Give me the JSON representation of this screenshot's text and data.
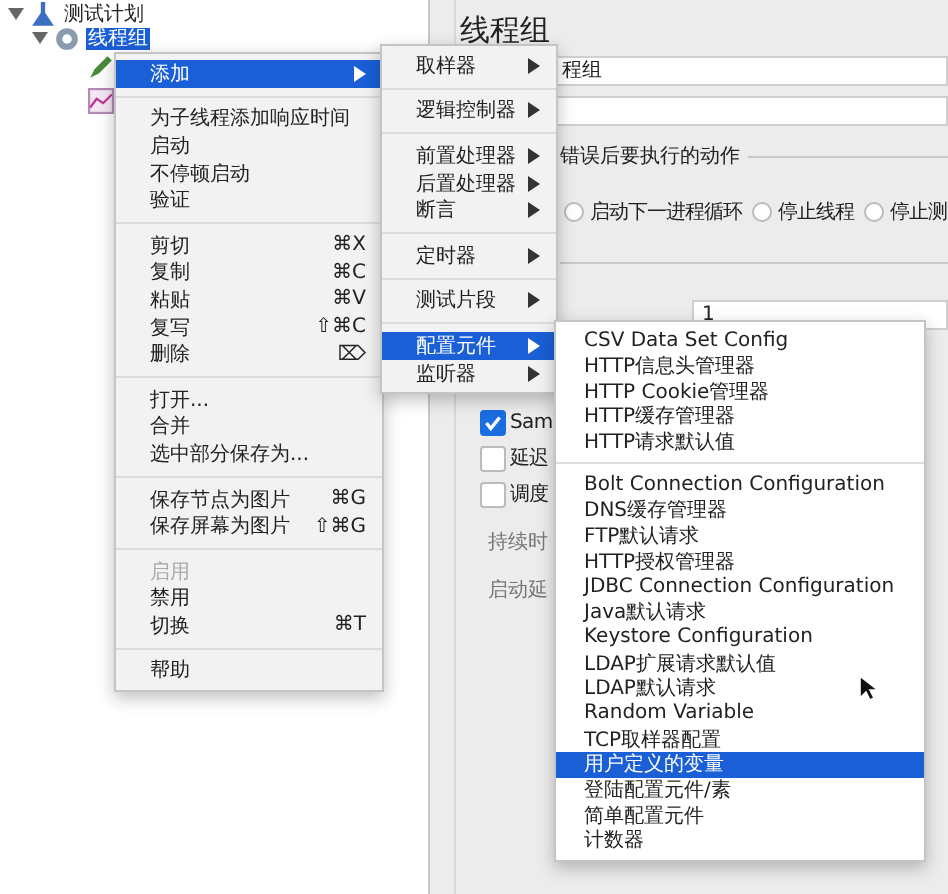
{
  "tree": [
    {
      "label": "测试计划",
      "kind": "plan",
      "expanded": true,
      "selected": false,
      "children": [
        {
          "label": "线程组",
          "kind": "threads",
          "expanded": true,
          "selected": true,
          "children": [
            {
              "kind": "sampler"
            },
            {
              "kind": "listener"
            }
          ]
        }
      ]
    }
  ],
  "panel": {
    "title": "线程组",
    "name_value": "程组",
    "action_legend": "错误后要执行的动作",
    "radios": [
      {
        "label": "启动下一进程循环",
        "selected": false
      },
      {
        "label": "停止线程",
        "selected": false
      },
      {
        "label": "停止测",
        "selected": false
      }
    ],
    "count_value": "1",
    "checkboxes": [
      {
        "label": "Sam",
        "checked": true
      },
      {
        "label": "延迟",
        "checked": false
      },
      {
        "label": "调度",
        "checked": false
      }
    ],
    "labels": [
      "持续时",
      "启动延"
    ]
  },
  "context_menu": [
    [
      {
        "label": "添加",
        "submenu": true,
        "selected": true,
        "disabled": false
      }
    ],
    [
      {
        "label": "为子线程添加响应时间",
        "submenu": false,
        "selected": false,
        "disabled": false
      },
      {
        "label": "启动",
        "submenu": false,
        "selected": false,
        "disabled": false
      },
      {
        "label": "不停顿启动",
        "submenu": false,
        "selected": false,
        "disabled": false
      },
      {
        "label": "验证",
        "submenu": false,
        "selected": false,
        "disabled": false
      }
    ],
    [
      {
        "label": "剪切",
        "shortcut": "⌘X",
        "submenu": false,
        "selected": false,
        "disabled": false
      },
      {
        "label": "复制",
        "shortcut": "⌘C",
        "submenu": false,
        "selected": false,
        "disabled": false
      },
      {
        "label": "粘贴",
        "shortcut": "⌘V",
        "submenu": false,
        "selected": false,
        "disabled": false
      },
      {
        "label": "复写",
        "shortcut": "⇧⌘C",
        "submenu": false,
        "selected": false,
        "disabled": false
      },
      {
        "label": "删除",
        "shortcut": "⌦",
        "submenu": false,
        "selected": false,
        "disabled": false
      }
    ],
    [
      {
        "label": "打开...",
        "submenu": false,
        "selected": false,
        "disabled": false
      },
      {
        "label": "合并",
        "submenu": false,
        "selected": false,
        "disabled": false
      },
      {
        "label": "选中部分保存为...",
        "submenu": false,
        "selected": false,
        "disabled": false
      }
    ],
    [
      {
        "label": "保存节点为图片",
        "shortcut": "⌘G",
        "submenu": false,
        "selected": false,
        "disabled": false
      },
      {
        "label": "保存屏幕为图片",
        "shortcut": "⇧⌘G",
        "submenu": false,
        "selected": false,
        "disabled": false
      }
    ],
    [
      {
        "label": "启用",
        "submenu": false,
        "selected": false,
        "disabled": true
      },
      {
        "label": "禁用",
        "submenu": false,
        "selected": false,
        "disabled": false
      },
      {
        "label": "切换",
        "shortcut": "⌘T",
        "submenu": false,
        "selected": false,
        "disabled": false
      }
    ],
    [
      {
        "label": "帮助",
        "submenu": false,
        "selected": false,
        "disabled": false
      }
    ]
  ],
  "add_menu": [
    [
      {
        "label": "取样器",
        "submenu": true,
        "selected": false
      }
    ],
    [
      {
        "label": "逻辑控制器",
        "submenu": true,
        "selected": false
      }
    ],
    [
      {
        "label": "前置处理器",
        "submenu": true,
        "selected": false
      },
      {
        "label": "后置处理器",
        "submenu": true,
        "selected": false
      },
      {
        "label": "断言",
        "submenu": true,
        "selected": false
      }
    ],
    [
      {
        "label": "定时器",
        "submenu": true,
        "selected": false
      }
    ],
    [
      {
        "label": "测试片段",
        "submenu": true,
        "selected": false
      }
    ],
    [
      {
        "label": "配置元件",
        "submenu": true,
        "selected": true
      },
      {
        "label": "监听器",
        "submenu": true,
        "selected": false
      }
    ]
  ],
  "config_menu": [
    [
      {
        "label": "CSV Data Set Config",
        "selected": false
      },
      {
        "label": "HTTP信息头管理器",
        "selected": false
      },
      {
        "label": "HTTP Cookie管理器",
        "selected": false
      },
      {
        "label": "HTTP缓存管理器",
        "selected": false
      },
      {
        "label": "HTTP请求默认值",
        "selected": false
      }
    ],
    [
      {
        "label": "Bolt Connection Configuration",
        "selected": false
      },
      {
        "label": "DNS缓存管理器",
        "selected": false
      },
      {
        "label": "FTP默认请求",
        "selected": false
      },
      {
        "label": "HTTP授权管理器",
        "selected": false
      },
      {
        "label": "JDBC Connection Configuration",
        "selected": false
      },
      {
        "label": "Java默认请求",
        "selected": false
      },
      {
        "label": "Keystore Configuration",
        "selected": false
      },
      {
        "label": "LDAP扩展请求默认值",
        "selected": false
      },
      {
        "label": "LDAP默认请求",
        "selected": false
      },
      {
        "label": "Random Variable",
        "selected": false
      },
      {
        "label": "TCP取样器配置",
        "selected": false
      },
      {
        "label": "用户定义的变量",
        "selected": true
      },
      {
        "label": "登陆配置元件/素",
        "selected": false
      },
      {
        "label": "简单配置元件",
        "selected": false
      },
      {
        "label": "计数器",
        "selected": false
      }
    ]
  ]
}
